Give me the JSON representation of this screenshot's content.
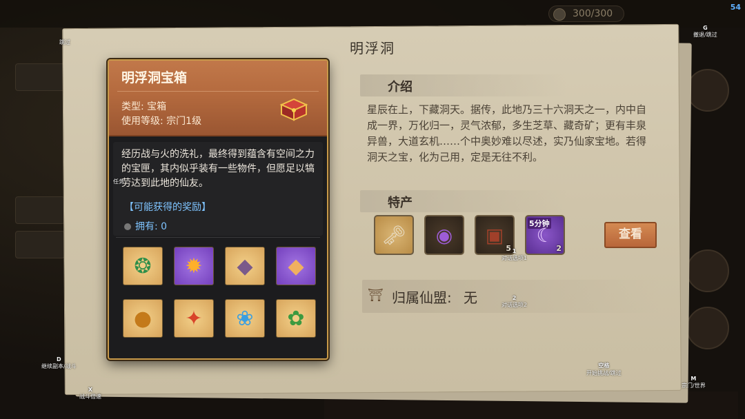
{
  "fps": "54",
  "background": {
    "resource_counter": "300/300"
  },
  "hints": {
    "skip": "跳过",
    "retreat": {
      "key": "G",
      "label": "撤退/跳过"
    },
    "task": "任务",
    "continue": {
      "key": "D",
      "label": "继续副本/战斗"
    },
    "battle_speed": {
      "key": "X",
      "label": "战斗倍速"
    },
    "start_challenge": {
      "key": "空格",
      "label": "开始挑战/跳过"
    },
    "sect_world": {
      "key": "M",
      "label": "宗门/世界"
    },
    "option1": {
      "key": "1",
      "label": "对话选项1"
    },
    "option2": {
      "key": "2",
      "label": "对话选项2"
    }
  },
  "window": {
    "title": "明浮洞",
    "intro": {
      "label": "介绍",
      "text": "星辰在上，下藏洞天。据传，此地乃三十六洞天之一，内中自成一界，万化归一，灵气浓郁，多生芝草、藏奇矿；更有丰泉异兽，大道玄机……个中奥妙难以尽述，实乃仙家宝地。若得洞天之宝，化为己用，定是无往不利。"
    },
    "specialties": {
      "label": "特产",
      "items": [
        {
          "icon": "golden-key-icon",
          "count": ""
        },
        {
          "icon": "purple-orb-icon",
          "count": ""
        },
        {
          "icon": "treasure-chest-icon",
          "count": "5"
        },
        {
          "icon": "purple-claw-icon",
          "count": "2",
          "tag": "5分钟"
        }
      ],
      "view_button": "查看"
    },
    "belonging": {
      "label": "归属仙盟:",
      "value": "无"
    }
  },
  "item_panel": {
    "name": "明浮洞宝箱",
    "type_label": "类型:",
    "type_value": "宝箱",
    "level_label": "使用等级:",
    "level_value": "宗门1级",
    "description": "经历战与火的洗礼，最终得到蕴含有空间之力的宝匣，其内似乎装有一些物件，但愿足以犒劳达到此地的仙友。",
    "reward_title": "【可能获得的奖励】",
    "own_label": "拥有:",
    "own_value": "0",
    "rewards": [
      {
        "icon": "jade-pendant-icon",
        "rarity": "gold"
      },
      {
        "icon": "fire-essence-icon",
        "rarity": "purple"
      },
      {
        "icon": "crystal-gold-icon",
        "rarity": "gold"
      },
      {
        "icon": "crystal-purple-icon",
        "rarity": "purple"
      },
      {
        "icon": "golden-fruit-icon",
        "rarity": "gold"
      },
      {
        "icon": "flame-seed-icon",
        "rarity": "gold"
      },
      {
        "icon": "ice-lotus-icon",
        "rarity": "gold"
      },
      {
        "icon": "green-gourd-icon",
        "rarity": "gold"
      }
    ]
  },
  "colors": {
    "panel_border": "#c89a4a",
    "header_bg": "#b46a3e",
    "reward_text": "#7fc4ff",
    "parchment": "#d2c8ae",
    "view_button": "#c77a48"
  }
}
